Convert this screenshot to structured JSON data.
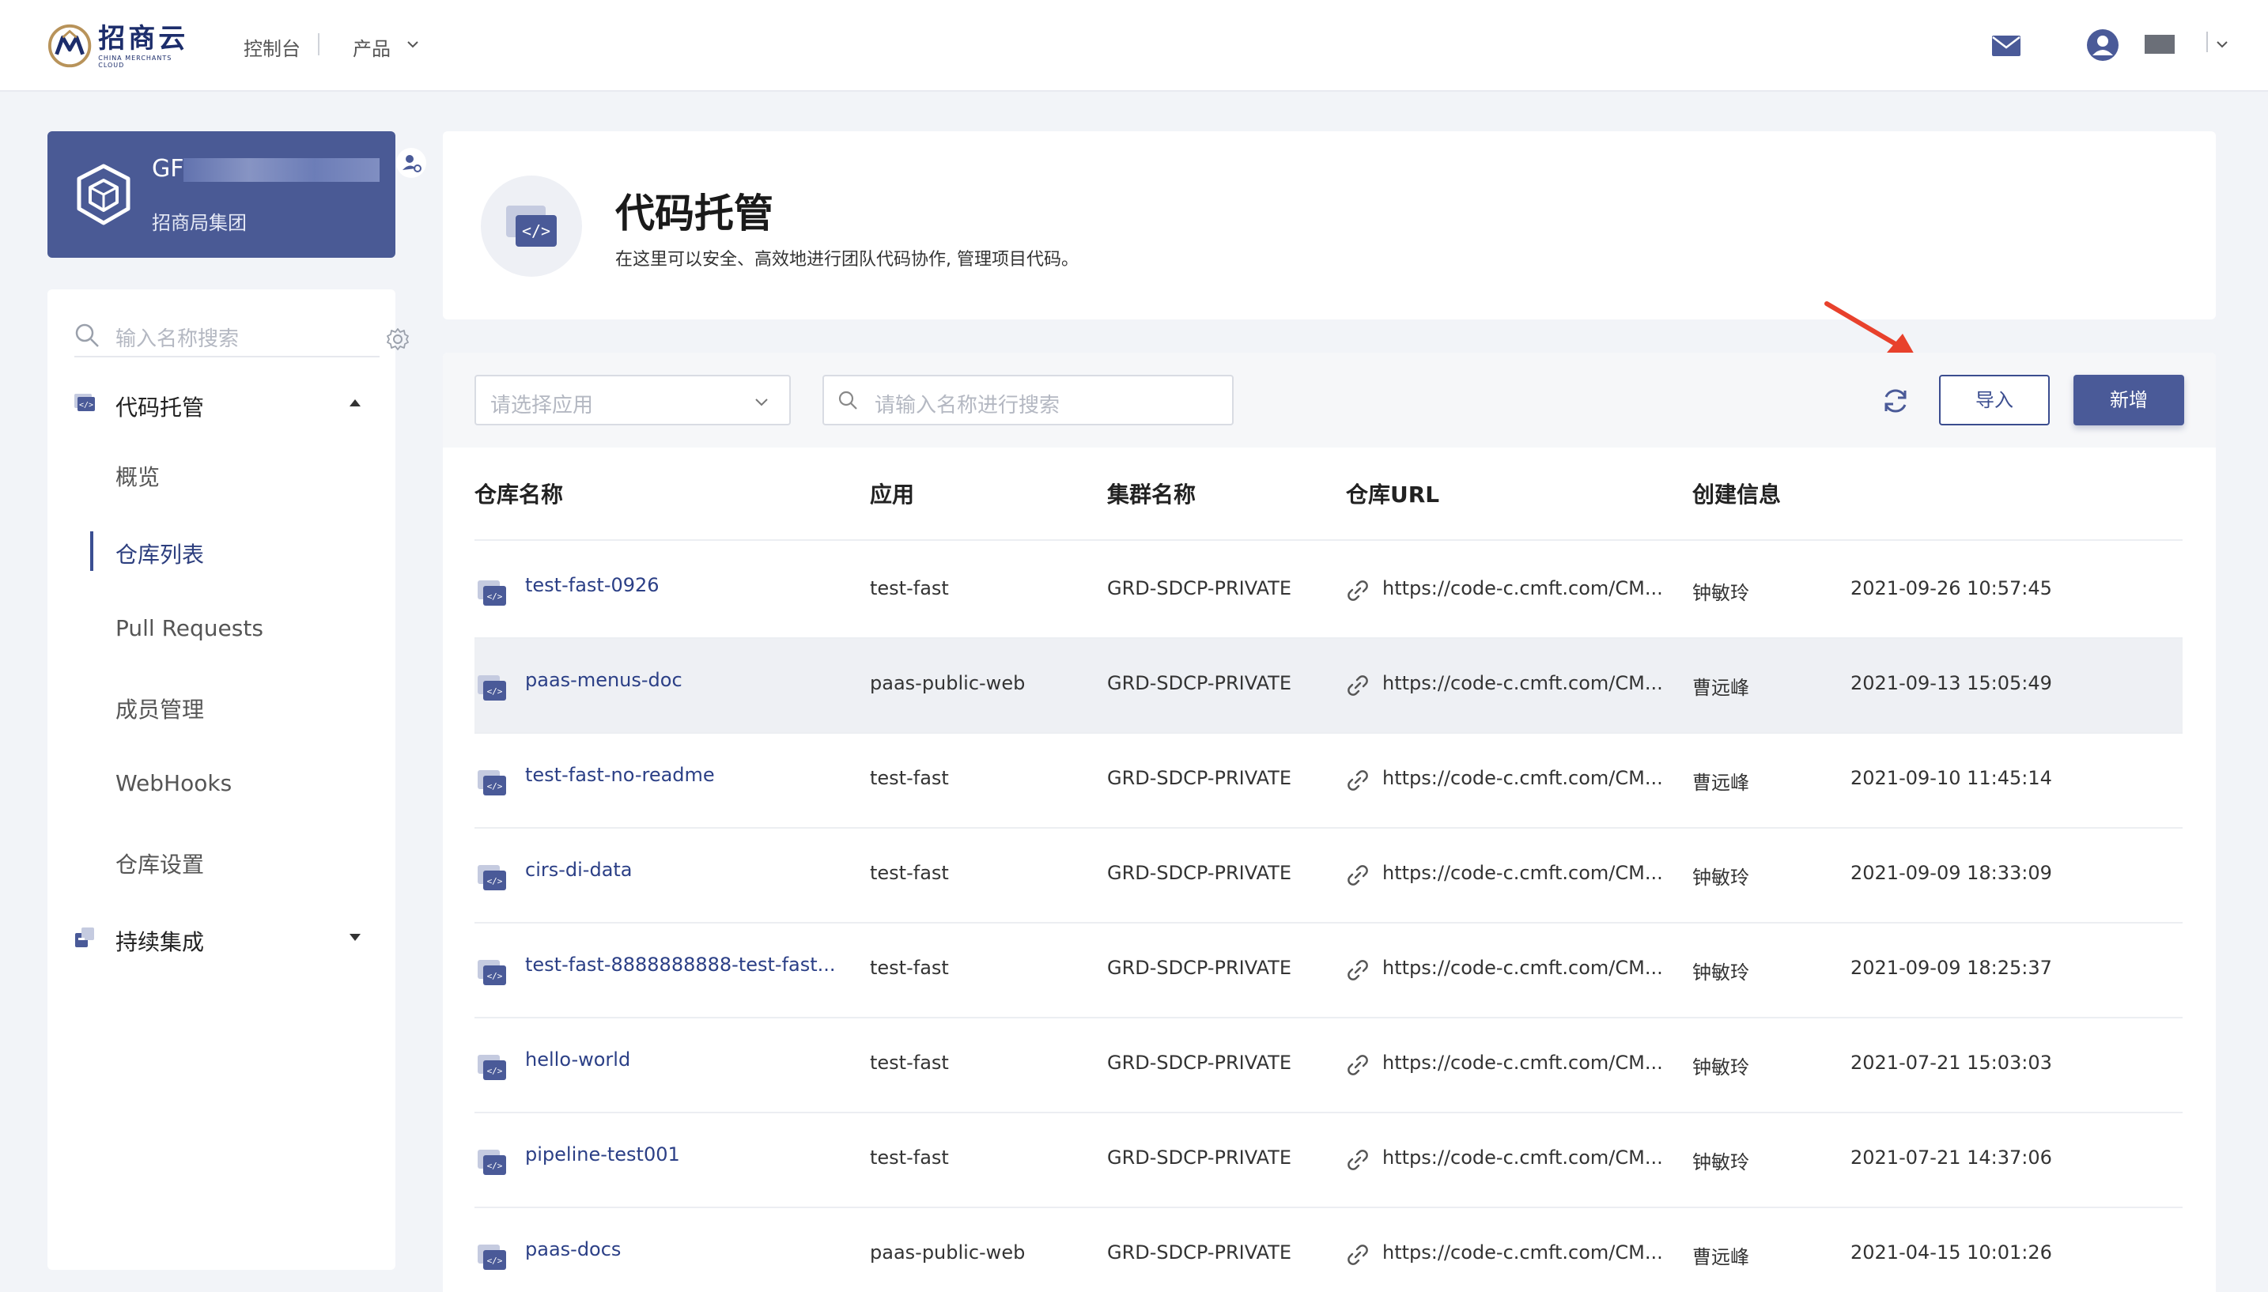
{
  "topbar": {
    "logo_cn": "招商云",
    "logo_en": "CHINA MERCHANTS CLOUD",
    "console_label": "控制台",
    "products_label": "产品"
  },
  "org": {
    "name": "GF",
    "subtitle": "招商局集团"
  },
  "sidebar": {
    "search_placeholder": "输入名称搜索",
    "groups": [
      {
        "label": "代码托管",
        "icon": "code-repo-icon",
        "expanded": true,
        "items": [
          {
            "label": "概览",
            "active": false
          },
          {
            "label": "仓库列表",
            "active": true
          },
          {
            "label": "Pull Requests",
            "active": false
          },
          {
            "label": "成员管理",
            "active": false
          },
          {
            "label": "WebHooks",
            "active": false
          },
          {
            "label": "仓库设置",
            "active": false
          }
        ]
      },
      {
        "label": "持续集成",
        "icon": "ci-icon",
        "expanded": false
      }
    ]
  },
  "header": {
    "title": "代码托管",
    "description": "在这里可以安全、高效地进行团队代码协作, 管理项目代码。"
  },
  "toolbar": {
    "app_select_placeholder": "请选择应用",
    "search_placeholder": "请输入名称进行搜索",
    "import_label": "导入",
    "add_label": "新增"
  },
  "table": {
    "columns": [
      "仓库名称",
      "应用",
      "集群名称",
      "仓库URL",
      "创建信息"
    ],
    "rows": [
      {
        "name": "test-fast-0926",
        "app": "test-fast",
        "cluster": "GRD-SDCP-PRIVATE",
        "url": "https://code-c.cmft.com/CM...",
        "creator": "钟敏玲",
        "created": "2021-09-26 10:57:45"
      },
      {
        "name": "paas-menus-doc",
        "app": "paas-public-web",
        "cluster": "GRD-SDCP-PRIVATE",
        "url": "https://code-c.cmft.com/CM...",
        "creator": "曹远峰",
        "created": "2021-09-13 15:05:49"
      },
      {
        "name": "test-fast-no-readme",
        "app": "test-fast",
        "cluster": "GRD-SDCP-PRIVATE",
        "url": "https://code-c.cmft.com/CM...",
        "creator": "曹远峰",
        "created": "2021-09-10 11:45:14"
      },
      {
        "name": "cirs-di-data",
        "app": "test-fast",
        "cluster": "GRD-SDCP-PRIVATE",
        "url": "https://code-c.cmft.com/CM...",
        "creator": "钟敏玲",
        "created": "2021-09-09 18:33:09"
      },
      {
        "name": "test-fast-8888888888-test-fast...",
        "app": "test-fast",
        "cluster": "GRD-SDCP-PRIVATE",
        "url": "https://code-c.cmft.com/CM...",
        "creator": "钟敏玲",
        "created": "2021-09-09 18:25:37"
      },
      {
        "name": "hello-world",
        "app": "test-fast",
        "cluster": "GRD-SDCP-PRIVATE",
        "url": "https://code-c.cmft.com/CM...",
        "creator": "钟敏玲",
        "created": "2021-07-21 15:03:03"
      },
      {
        "name": "pipeline-test001",
        "app": "test-fast",
        "cluster": "GRD-SDCP-PRIVATE",
        "url": "https://code-c.cmft.com/CM...",
        "creator": "钟敏玲",
        "created": "2021-07-21 14:37:06"
      },
      {
        "name": "paas-docs",
        "app": "paas-public-web",
        "cluster": "GRD-SDCP-PRIVATE",
        "url": "https://code-c.cmft.com/CM...",
        "creator": "曹远峰",
        "created": "2021-04-15 10:01:26"
      }
    ]
  },
  "colors": {
    "brand": "#4a5a98",
    "link": "#2b3f86",
    "annotation_arrow": "#e8412c"
  }
}
